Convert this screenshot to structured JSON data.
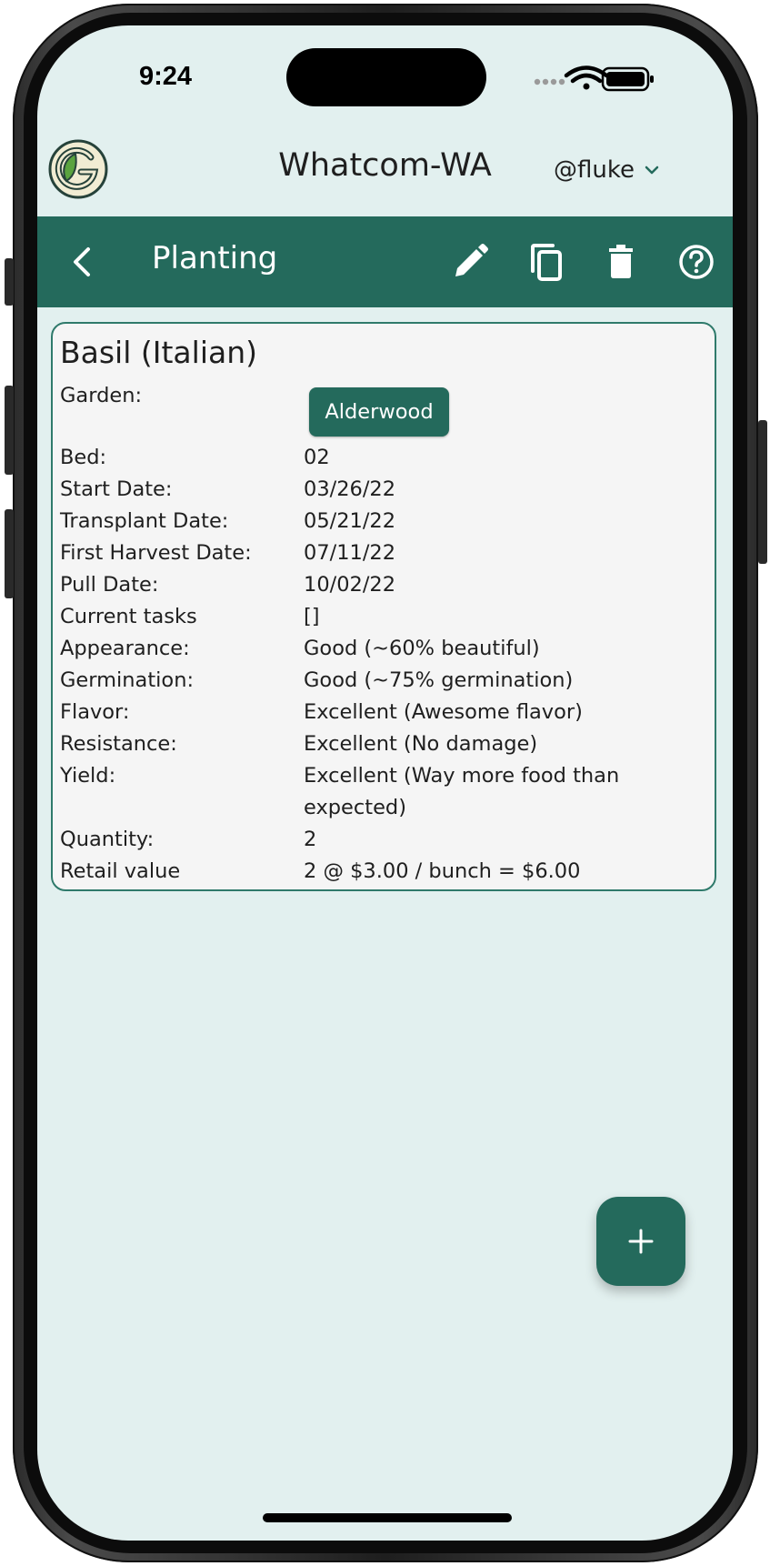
{
  "status_bar": {
    "time": "9:24"
  },
  "header": {
    "garden_name": "Whatcom-WA",
    "user": "@fluke",
    "logo_icon": "garden-logo-icon"
  },
  "toolbar": {
    "title": "Planting",
    "icons": [
      "back-arrow-icon",
      "edit-pencil-icon",
      "copy-icon",
      "trash-icon",
      "help-circle-icon"
    ]
  },
  "planting": {
    "title": "Basil (Italian)",
    "garden_label": "Garden:",
    "garden_value": "Alderwood",
    "rows": [
      {
        "label": "Bed:",
        "value": "02"
      },
      {
        "label": "Start Date:",
        "value": "03/26/22"
      },
      {
        "label": "Transplant Date:",
        "value": "05/21/22"
      },
      {
        "label": "First Harvest Date:",
        "value": "07/11/22"
      },
      {
        "label": "Pull Date:",
        "value": "10/02/22"
      },
      {
        "label": "Current tasks",
        "value": "[]"
      },
      {
        "label": "Appearance:",
        "value": "Good (~60% beautiful)"
      },
      {
        "label": "Germination:",
        "value": "Good (~75% germination)"
      },
      {
        "label": "Flavor:",
        "value": "Excellent (Awesome flavor)"
      },
      {
        "label": "Resistance:",
        "value": "Excellent (No damage)"
      },
      {
        "label": "Yield:",
        "value": "Excellent (Way more food than",
        "value2": "expected)"
      },
      {
        "label": "Quantity:",
        "value": "2"
      },
      {
        "label": "Retail value",
        "value": "2 @ $3.00 / bunch  = $6.00"
      }
    ]
  },
  "fab": {
    "icon": "plus-icon"
  },
  "colors": {
    "primary": "#246a5c",
    "background": "#e2f0ef",
    "card": "#f5f5f5"
  }
}
